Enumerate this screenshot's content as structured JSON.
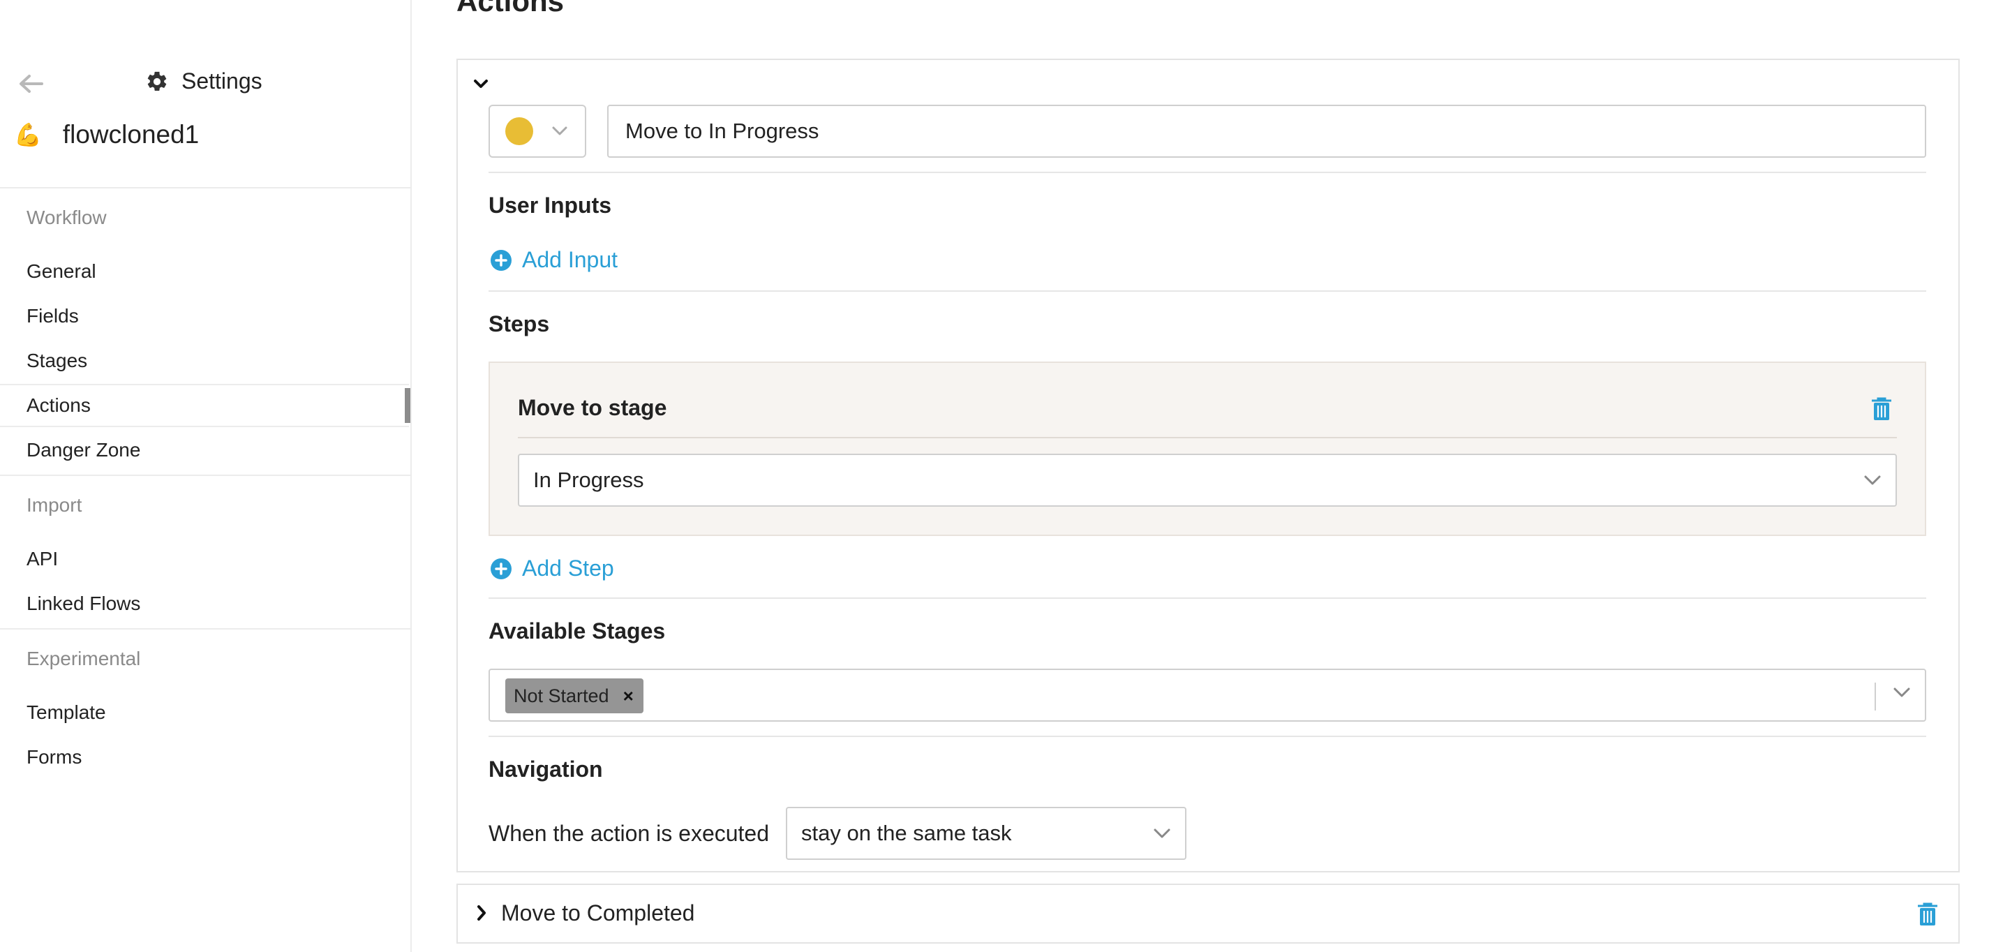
{
  "sidebar": {
    "settings_label": "Settings",
    "flow_name": "flowcloned1",
    "flow_emoji": "💪",
    "sections": [
      {
        "label": "Workflow",
        "items": [
          "General",
          "Fields",
          "Stages",
          "Actions",
          "Danger Zone"
        ]
      },
      {
        "label": "Import",
        "items": [
          "API",
          "Linked Flows"
        ]
      },
      {
        "label": "Experimental",
        "items": [
          "Template",
          "Forms"
        ]
      }
    ],
    "active_item": "Actions"
  },
  "main": {
    "heading": "Actions",
    "action1": {
      "color": "#e8bd35",
      "name": "Move to In Progress",
      "user_inputs_title": "User Inputs",
      "add_input_label": "Add Input",
      "steps_title": "Steps",
      "step": {
        "title": "Move to stage",
        "stage_value": "In Progress"
      },
      "add_step_label": "Add Step",
      "available_stages_title": "Available Stages",
      "available_stages": [
        "Not Started"
      ],
      "navigation_title": "Navigation",
      "navigation_text": "When the action is executed",
      "navigation_value": "stay on the same task"
    },
    "action2": {
      "name": "Move to Completed"
    }
  },
  "colors": {
    "accent": "#2a9fd6",
    "step_bg": "#f7f4f1",
    "tag_bg": "#959595"
  },
  "icons": [
    "back-arrow-icon",
    "gear-icon",
    "flexed-biceps-icon",
    "chevron-down-icon",
    "chevron-right-icon",
    "plus-circle-icon",
    "trash-icon",
    "close-icon"
  ]
}
